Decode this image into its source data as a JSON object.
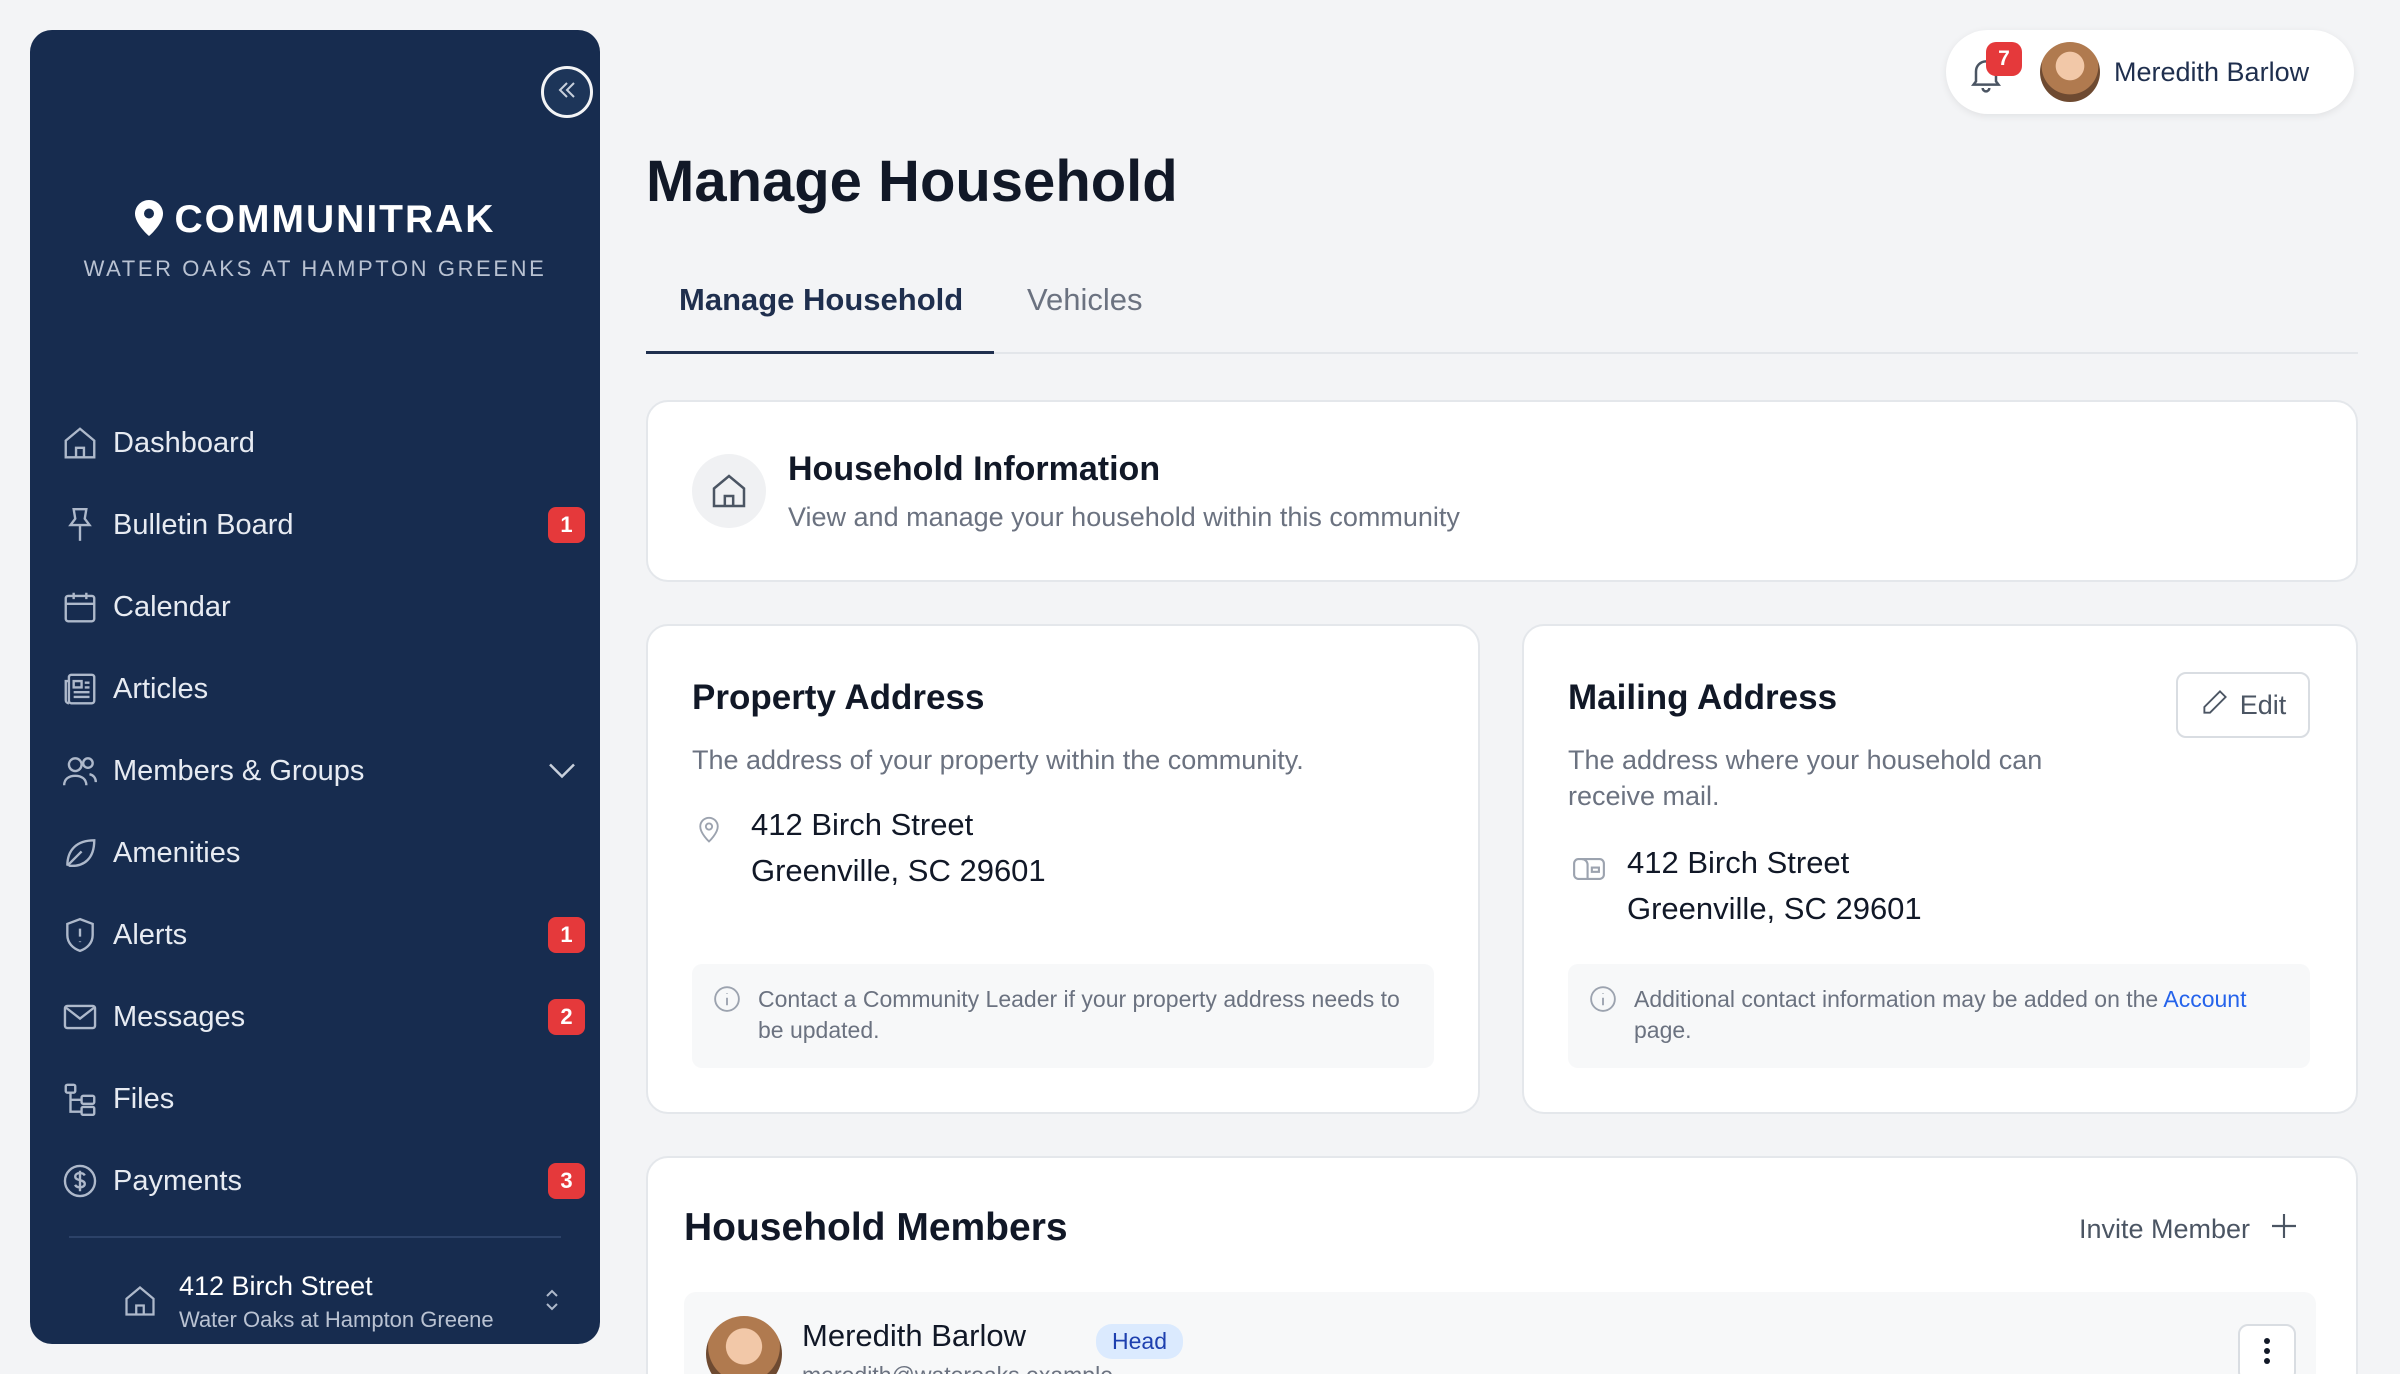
{
  "brand": {
    "name": "COMMUNITRAK",
    "community": "WATER OAKS AT HAMPTON GREENE"
  },
  "sidebar": {
    "items": [
      {
        "label": "Dashboard",
        "icon": "home-icon",
        "badge": null
      },
      {
        "label": "Bulletin Board",
        "icon": "pin-icon",
        "badge": "1"
      },
      {
        "label": "Calendar",
        "icon": "calendar-icon",
        "badge": null
      },
      {
        "label": "Articles",
        "icon": "newspaper-icon",
        "badge": null
      },
      {
        "label": "Members & Groups",
        "icon": "users-icon",
        "badge": null,
        "expandable": true
      },
      {
        "label": "Amenities",
        "icon": "leaf-icon",
        "badge": null
      },
      {
        "label": "Alerts",
        "icon": "shield-alert-icon",
        "badge": "1"
      },
      {
        "label": "Messages",
        "icon": "mail-icon",
        "badge": "2"
      },
      {
        "label": "Files",
        "icon": "folder-tree-icon",
        "badge": null
      },
      {
        "label": "Payments",
        "icon": "dollar-circle-icon",
        "badge": "3"
      }
    ],
    "household": {
      "address": "412 Birch Street",
      "community": "Water Oaks at Hampton Greene"
    }
  },
  "topbar": {
    "notification_count": "7",
    "user_name": "Meredith Barlow"
  },
  "page": {
    "title": "Manage Household",
    "tabs": [
      {
        "label": "Manage Household",
        "active": true
      },
      {
        "label": "Vehicles",
        "active": false
      }
    ]
  },
  "household_info": {
    "title": "Household Information",
    "subtitle": "View and manage your household within this community"
  },
  "property_address": {
    "title": "Property Address",
    "description": "The address of your property within the community.",
    "line1": "412 Birch Street",
    "line2": "Greenville, SC 29601",
    "note": "Contact a Community Leader if your property address needs to be updated."
  },
  "mailing_address": {
    "title": "Mailing Address",
    "description_line1": "The address where your household can",
    "description_line2": "receive mail.",
    "edit_label": "Edit",
    "line1": "412 Birch Street",
    "line2": "Greenville, SC 29601",
    "note_prefix": "Additional contact information may be added on the",
    "note_link": "Account",
    "note_suffix": "page."
  },
  "members": {
    "title": "Household Members",
    "invite_label": "Invite Member",
    "list": [
      {
        "name": "Meredith Barlow",
        "badge": "Head",
        "email": "meredith@wateroaks.example"
      }
    ]
  },
  "colors": {
    "sidebar_bg": "#172c4f",
    "badge_red": "#e5393b",
    "link_blue": "#2563eb",
    "accent_navy": "#1f2f4e"
  }
}
